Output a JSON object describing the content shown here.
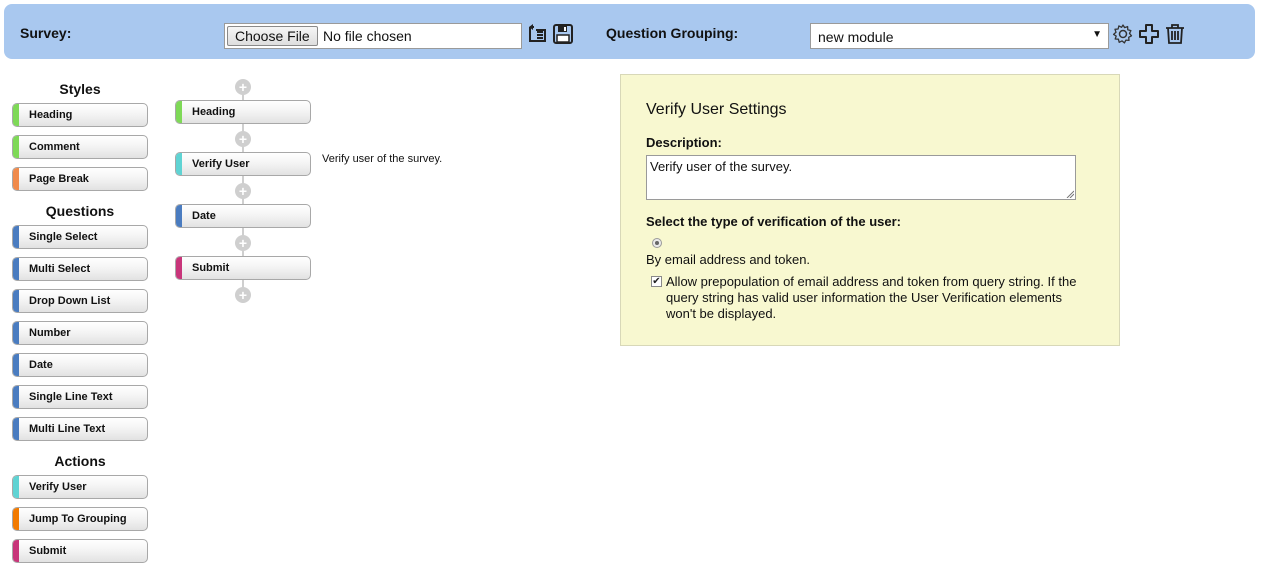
{
  "topbar": {
    "survey_label": "Survey:",
    "choose_file_label": "Choose File",
    "no_file_text": "No file chosen",
    "grouping_label": "Question Grouping:",
    "grouping_value": "new module",
    "icons": [
      "import-icon",
      "save-icon",
      "settings-gear-icon",
      "add-plus-icon",
      "delete-trash-icon"
    ]
  },
  "palette": {
    "styles_title": "Styles",
    "styles": [
      {
        "label": "Heading",
        "color": "#7ed957"
      },
      {
        "label": "Comment",
        "color": "#7ed957"
      },
      {
        "label": "Page Break",
        "color": "#f08a4b"
      }
    ],
    "questions_title": "Questions",
    "questions": [
      {
        "label": "Single Select",
        "color": "#4a7cc0"
      },
      {
        "label": "Multi Select",
        "color": "#4a7cc0"
      },
      {
        "label": "Drop Down List",
        "color": "#4a7cc0"
      },
      {
        "label": "Number",
        "color": "#4a7cc0"
      },
      {
        "label": "Date",
        "color": "#4a7cc0"
      },
      {
        "label": "Single Line Text",
        "color": "#4a7cc0"
      },
      {
        "label": "Multi Line Text",
        "color": "#4a7cc0"
      }
    ],
    "actions_title": "Actions",
    "actions": [
      {
        "label": "Verify User",
        "color": "#5fd3d3"
      },
      {
        "label": "Jump To Grouping",
        "color": "#f27a00"
      },
      {
        "label": "Submit",
        "color": "#c8357a"
      }
    ]
  },
  "flow": {
    "items": [
      {
        "label": "Heading",
        "color": "#7ed957"
      },
      {
        "label": "Verify User",
        "color": "#5fd3d3"
      },
      {
        "label": "Date",
        "color": "#4a7cc0"
      },
      {
        "label": "Submit",
        "color": "#c8357a"
      }
    ],
    "selected_description": "Verify user of the survey."
  },
  "settings": {
    "title": "Verify User Settings",
    "description_label": "Description:",
    "description_value": "Verify user of the survey.",
    "verification_label": "Select the type of verification of the user:",
    "radio_option": "By email address and token.",
    "checkbox_label": "Allow prepopulation of email address and token from query string. If the query string has valid user information the User Verification elements won't be displayed.",
    "checkbox_checked": true
  }
}
